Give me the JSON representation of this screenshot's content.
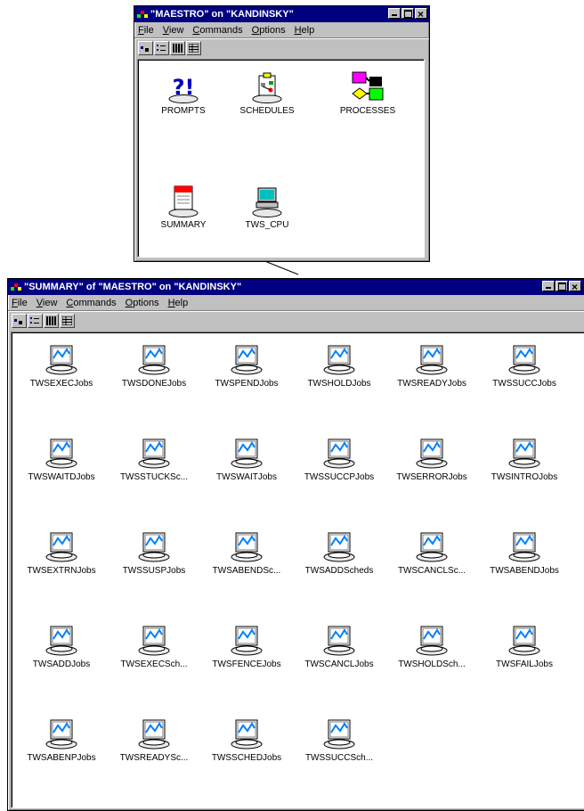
{
  "main_window": {
    "title": "\"MAESTRO\" on \"KANDINSKY\"",
    "menu": [
      "File",
      "View",
      "Commands",
      "Options",
      "Help"
    ],
    "items": [
      {
        "label": "PROMPTS",
        "icon": "prompts-icon"
      },
      {
        "label": "SCHEDULES",
        "icon": "schedules-icon"
      },
      {
        "label": "PROCESSES",
        "icon": "processes-icon"
      },
      {
        "label": "SUMMARY",
        "icon": "summary-icon"
      },
      {
        "label": "TWS_CPU",
        "icon": "computer-icon"
      }
    ]
  },
  "summary_window": {
    "title": "\"SUMMARY\" of \"MAESTRO\" on \"KANDINSKY\"",
    "menu": [
      "File",
      "View",
      "Commands",
      "Options",
      "Help"
    ],
    "items": [
      "TWSEXECJobs",
      "TWSDONEJobs",
      "TWSPENDJobs",
      "TWSHOLDJobs",
      "TWSREADYJobs",
      "TWSSUCCJobs",
      "TWSWAITDJobs",
      "TWSSTUCKSc...",
      "TWSWAITJobs",
      "TWSSUCCPJobs",
      "TWSERRORJobs",
      "TWSINTROJobs",
      "TWSEXTRNJobs",
      "TWSSUSPJobs",
      "TWSABENDSc...",
      "TWSADDScheds",
      "TWSCANCLSc...",
      "TWSABENDJobs",
      "TWSADDJobs",
      "TWSEXECSch...",
      "TWSFENCEJobs",
      "TWSCANCLJobs",
      "TWSHOLDSch...",
      "TWSFAILJobs",
      "TWSABENPJobs",
      "TWSREADYSc...",
      "TWSSCHEDJobs",
      "TWSSUCCSch..."
    ]
  },
  "toolbar_icons": [
    "large-icons-view-icon",
    "small-icons-view-icon",
    "list-view-icon",
    "details-view-icon"
  ]
}
